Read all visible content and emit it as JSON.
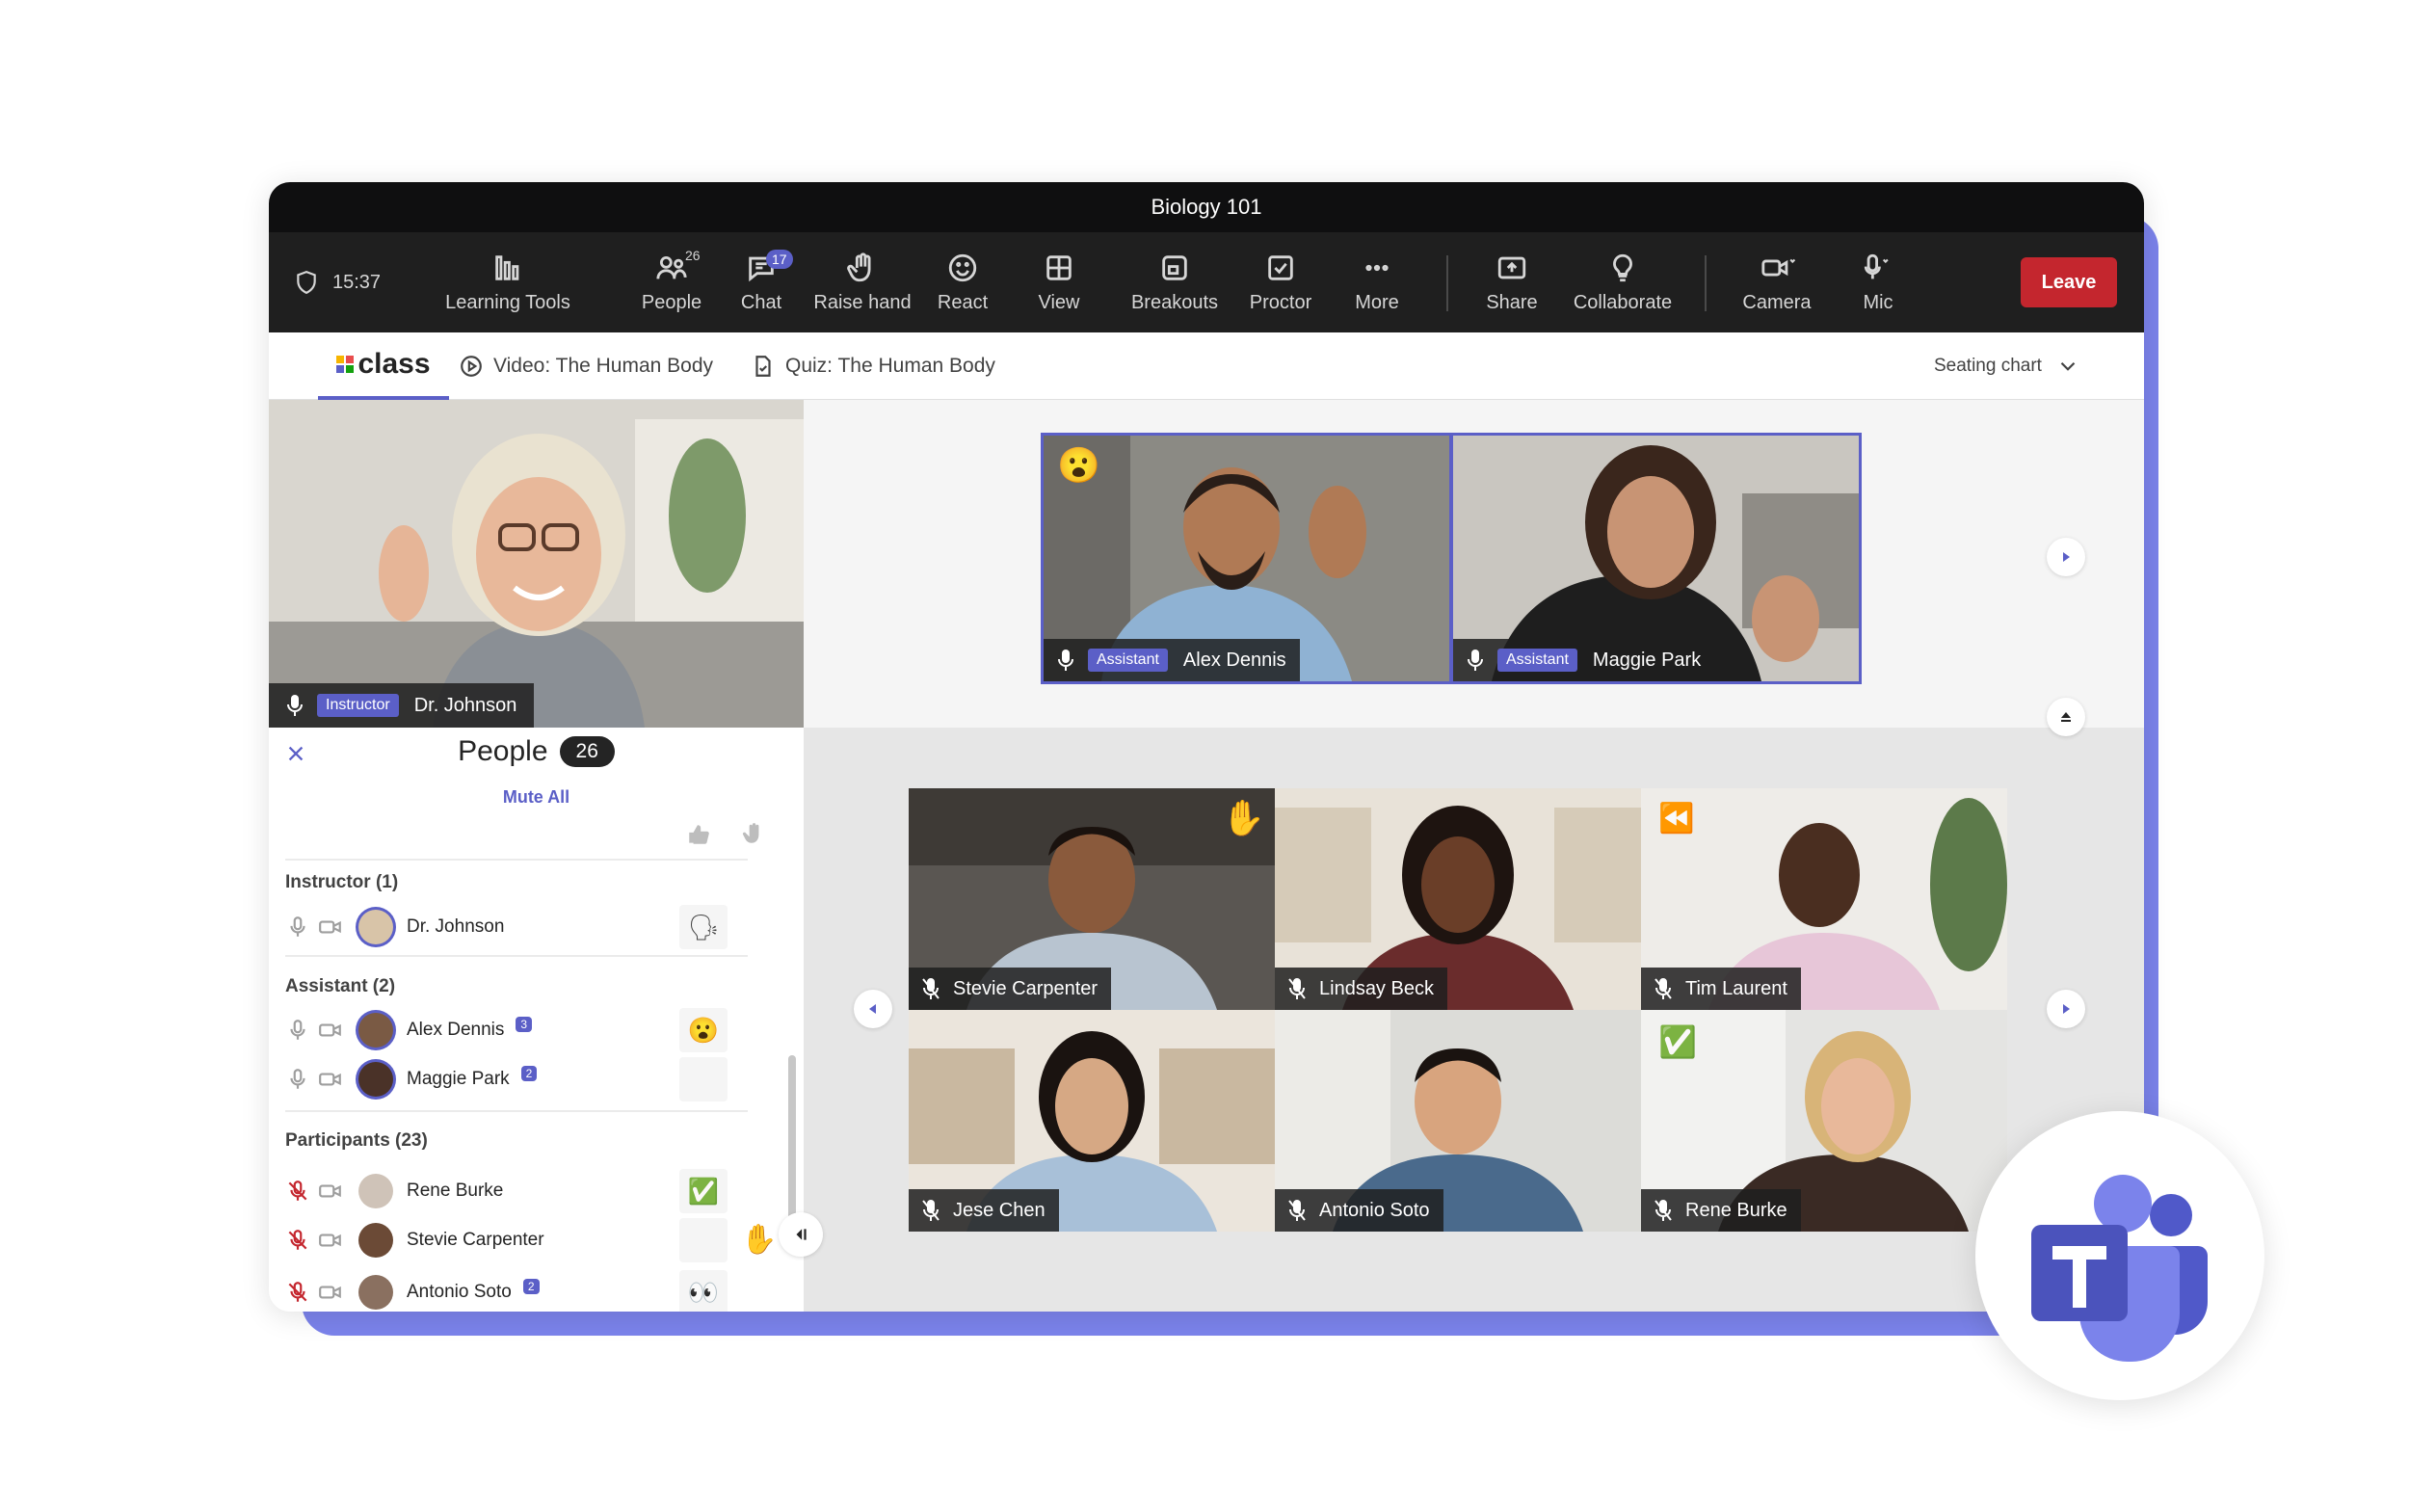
{
  "window": {
    "title": "Biology 101"
  },
  "toolbar": {
    "timer": "15:37",
    "items": [
      {
        "label": "Learning Tools",
        "icon": "learning-tools-icon"
      },
      {
        "label": "People",
        "icon": "people-icon",
        "badge": "26"
      },
      {
        "label": "Chat",
        "icon": "chat-icon",
        "badge": "17"
      },
      {
        "label": "Raise hand",
        "icon": "hand-icon"
      },
      {
        "label": "React",
        "icon": "smile-icon"
      },
      {
        "label": "View",
        "icon": "view-icon"
      },
      {
        "label": "Breakouts",
        "icon": "breakouts-icon"
      },
      {
        "label": "Proctor",
        "icon": "proctor-icon"
      },
      {
        "label": "More",
        "icon": "more-icon"
      },
      {
        "label": "Share",
        "icon": "share-icon"
      },
      {
        "label": "Collaborate",
        "icon": "lightbulb-icon"
      },
      {
        "label": "Camera",
        "icon": "camera-icon"
      },
      {
        "label": "Mic",
        "icon": "mic-icon"
      }
    ],
    "leave_label": "Leave"
  },
  "tabs": {
    "logo_text": "class",
    "video": "Video: The Human Body",
    "quiz": "Quiz: The Human Body",
    "seating": "Seating chart"
  },
  "instructor_video": {
    "role": "Instructor",
    "name": "Dr. Johnson"
  },
  "people_panel": {
    "title": "People",
    "count": "26",
    "mute_all": "Mute All",
    "sections": [
      {
        "title": "Instructor (1)",
        "members": [
          {
            "name": "Dr. Johnson",
            "status": "🗣"
          }
        ]
      },
      {
        "title": "Assistant (2)",
        "members": [
          {
            "name": "Alex Dennis",
            "chat": "3",
            "status": "😮"
          },
          {
            "name": "Maggie Park",
            "chat": "2",
            "status": ""
          }
        ]
      },
      {
        "title": "Participants (23)",
        "members": [
          {
            "name": "Rene Burke",
            "status": "✅"
          },
          {
            "name": "Stevie Carpenter",
            "status": "",
            "hand": "✋"
          },
          {
            "name": "Antonio Soto",
            "chat": "2",
            "status": "👀"
          }
        ]
      }
    ]
  },
  "featured": [
    {
      "role": "Assistant",
      "name": "Alex Dennis",
      "reaction": "😮"
    },
    {
      "role": "Assistant",
      "name": "Maggie Park"
    }
  ],
  "grid": [
    {
      "name": "Stevie Carpenter",
      "reaction": "✋"
    },
    {
      "name": "Lindsay Beck"
    },
    {
      "name": "Tim Laurent",
      "reaction": "⏪"
    },
    {
      "name": "Jese Chen"
    },
    {
      "name": "Antonio Soto"
    },
    {
      "name": "Rene Burke",
      "reaction": "✅"
    }
  ],
  "colors": {
    "accent": "#5b5fc7",
    "leave": "#c4262e",
    "backdrop": "#7b83eb",
    "titlebar": "#0f0f10",
    "toolbar": "#1f1f1f"
  }
}
